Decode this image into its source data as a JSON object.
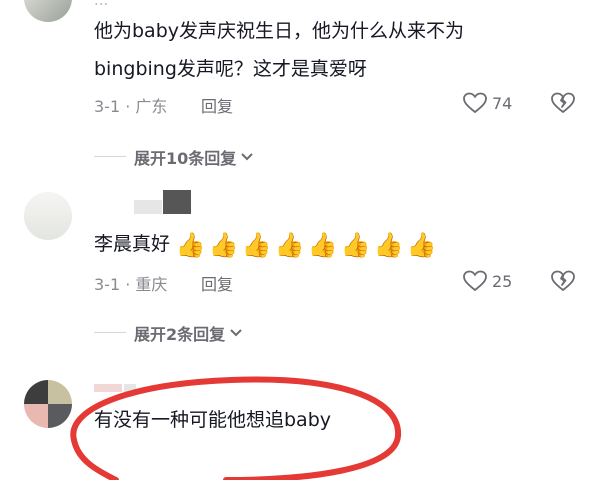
{
  "comments": [
    {
      "name": "...",
      "text_line1": "他为baby发声庆祝生日，他为什么从来不为",
      "text_line2": "bingbing发声呢？这才是真爱呀",
      "date_loc": "3-1 · 广东",
      "reply": "回复",
      "likes": "74",
      "expand": "展开10条回复"
    },
    {
      "name": "",
      "text": "李晨真好",
      "emoji": "👍",
      "emoji_count": 8,
      "date_loc": "3-1 · 重庆",
      "reply": "回复",
      "likes": "25",
      "expand": "展开2条回复"
    },
    {
      "name": "",
      "text": "有没有一种可能他想追baby"
    }
  ],
  "colors": {
    "highlight_circle": "#e53935",
    "text_primary": "#161823",
    "text_secondary": "#8a8b91"
  },
  "icons": [
    "heart-icon",
    "broken-heart-icon",
    "chevron-down-icon"
  ]
}
